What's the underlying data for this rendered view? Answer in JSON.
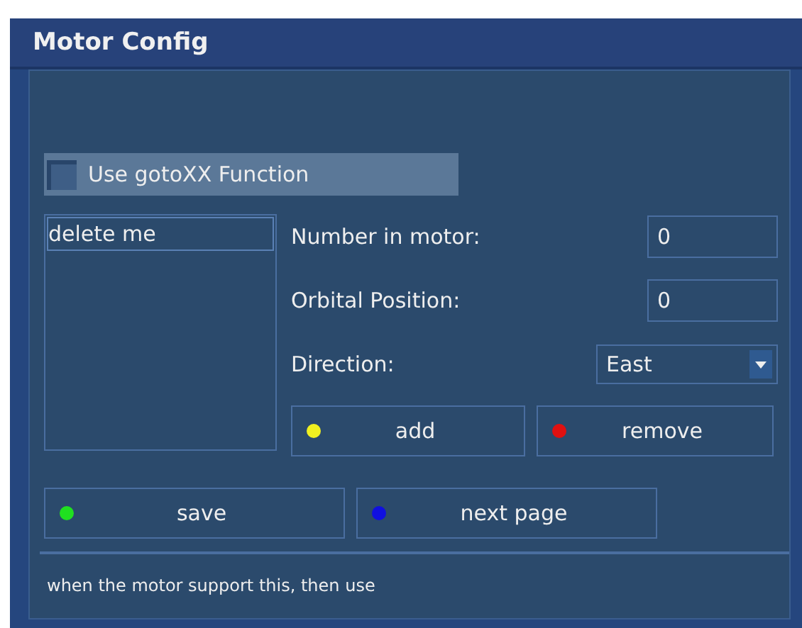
{
  "window": {
    "title": "Motor Config"
  },
  "checkbox": {
    "label": "Use gotoXX Function",
    "checked": false,
    "focused": true
  },
  "list": {
    "items": [
      {
        "label": "delete me",
        "selected": true
      }
    ]
  },
  "fields": [
    {
      "label": "Number in motor:",
      "kind": "input",
      "value": "0"
    },
    {
      "label": "Orbital Position:",
      "kind": "input",
      "value": "0"
    },
    {
      "label": "Direction:",
      "kind": "dropdown",
      "value": "East"
    }
  ],
  "row_buttons": [
    {
      "label": "add",
      "color": "#f0f020"
    },
    {
      "label": "remove",
      "color": "#e01010"
    }
  ],
  "bottom_buttons": [
    {
      "label": "save",
      "color": "#20e020"
    },
    {
      "label": "next page",
      "color": "#1010e0"
    }
  ],
  "status_bar": "when the motor support this, then use"
}
